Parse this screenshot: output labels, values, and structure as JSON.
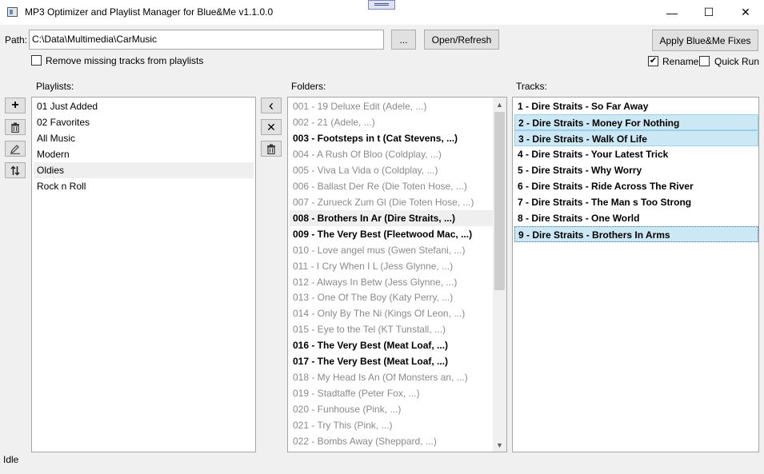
{
  "window": {
    "title": "MP3 Optimizer and Playlist Manager for Blue&Me v1.1.0.0",
    "minimize": "—",
    "maximize": "☐",
    "close": "✕"
  },
  "path": {
    "label": "Path:",
    "value": "C:\\Data\\Multimedia\\CarMusic",
    "browse_label": "...",
    "open_refresh_label": "Open/Refresh"
  },
  "remove_missing": {
    "label": "Remove missing tracks from playlists",
    "checked": false
  },
  "apply_button": "Apply Blue&Me Fixes",
  "rename": {
    "label": "Rename",
    "checked": true
  },
  "quick_run": {
    "label": "Quick Run",
    "checked": false
  },
  "playlists": {
    "label": "Playlists:",
    "items": [
      "01 Just Added",
      "02 Favorites",
      "All Music",
      "Modern",
      "Oldies",
      "Rock n Roll"
    ]
  },
  "folders": {
    "label": "Folders:",
    "items": [
      "001 - 19 Deluxe Edit (Adele, ...)",
      "002 - 21 (Adele, ...)",
      "003 - Footsteps in t (Cat Stevens, ...)",
      "004 - A Rush Of Bloo (Coldplay, ...)",
      "005 - Viva La Vida o (Coldplay, ...)",
      "006 - Ballast Der Re (Die Toten Hose, ...)",
      "007 - Zurueck Zum Gl (Die Toten Hose, ...)",
      "008 - Brothers In Ar (Dire Straits, ...)",
      "009 - The Very Best (Fleetwood Mac, ...)",
      "010 - Love angel mus (Gwen Stefani, ...)",
      "011 - I Cry When I L (Jess Glynne, ...)",
      "012 - Always In Betw (Jess Glynne, ...)",
      "013 - One Of The Boy (Katy Perry, ...)",
      "014 - Only By The Ni (Kings Of Leon, ...)",
      "015 - Eye to the Tel (KT Tunstall, ...)",
      "016 - The Very Best (Meat Loaf, ...)",
      "017 - The Very Best (Meat Loaf, ...)",
      "018 - My Head Is An (Of Monsters an, ...)",
      "019 - Stadtaffe (Peter Fox, ...)",
      "020 - Funhouse (Pink, ...)",
      "021 - Try This (Pink, ...)",
      "022 - Bombs Away (Sheppard, ...)"
    ]
  },
  "tracks": {
    "label": "Tracks:",
    "items": [
      "1 - Dire Straits - So Far Away",
      "2 - Dire Straits - Money For Nothing",
      "3 - Dire Straits - Walk Of Life",
      "4 - Dire Straits - Your Latest Trick",
      "5 - Dire Straits - Why Worry",
      "6 - Dire Straits - Ride Across The River",
      "7 - Dire Straits - The Man s Too Strong",
      "8 - Dire Straits - One World",
      "9 - Dire Straits - Brothers In Arms"
    ]
  },
  "playlist_buttons": [
    {
      "icon": "plus-icon",
      "glyph": "+"
    },
    {
      "icon": "trash-icon",
      "glyph": "🗑"
    },
    {
      "icon": "rename-icon",
      "glyph": "✎"
    },
    {
      "icon": "sort-icon",
      "glyph": "⇅"
    }
  ],
  "folder_buttons": [
    {
      "icon": "chevron-left-icon",
      "glyph": "‹"
    },
    {
      "icon": "close-icon",
      "glyph": "✕"
    },
    {
      "icon": "trash-icon",
      "glyph": "🗑"
    }
  ],
  "status": "Idle",
  "colors": {
    "selection_bg": "#cce8f4",
    "selection_border": "#99d1ea",
    "disabled_text": "#8a8a8a"
  }
}
